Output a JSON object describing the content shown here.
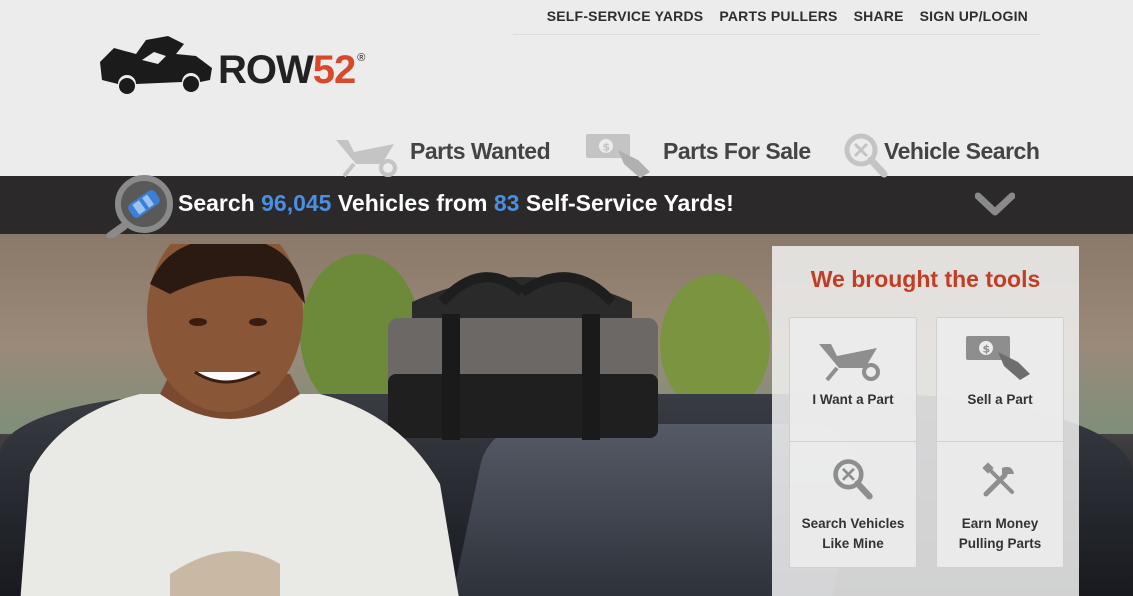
{
  "topnav": {
    "items": [
      "SELF-SERVICE YARDS",
      "PARTS PULLERS",
      "SHARE",
      "SIGN UP/LOGIN"
    ]
  },
  "logo": {
    "text": "ROW",
    "number": "52",
    "registered": "®",
    "accent_color": "#d8482a"
  },
  "mainnav": {
    "items": [
      {
        "label": "Parts Wanted",
        "icon": "wheelbarrow-icon"
      },
      {
        "label": "Parts For Sale",
        "icon": "cash-hand-icon"
      },
      {
        "label": "Vehicle Search",
        "icon": "magnifier-icon"
      }
    ]
  },
  "searchbar": {
    "prefix": "Search",
    "vehicles": "96,045",
    "middle": "Vehicles from",
    "yards": "83",
    "suffix": "Self-Service Yards!",
    "number_color": "#4a8fe0",
    "icon": "car-search-icon",
    "toggle_icon": "chevron-down-icon"
  },
  "tools": {
    "title": "We brought the tools",
    "title_color": "#c23d24",
    "tiles": [
      {
        "label": "I Want a Part",
        "icon": "wheelbarrow-icon"
      },
      {
        "label": "Sell a Part",
        "icon": "cash-hand-icon"
      },
      {
        "label": "Search Vehicles\nLike Mine",
        "icon": "magnifier-icon"
      },
      {
        "label": "Earn Money\nPulling Parts",
        "icon": "tools-icon"
      }
    ]
  }
}
